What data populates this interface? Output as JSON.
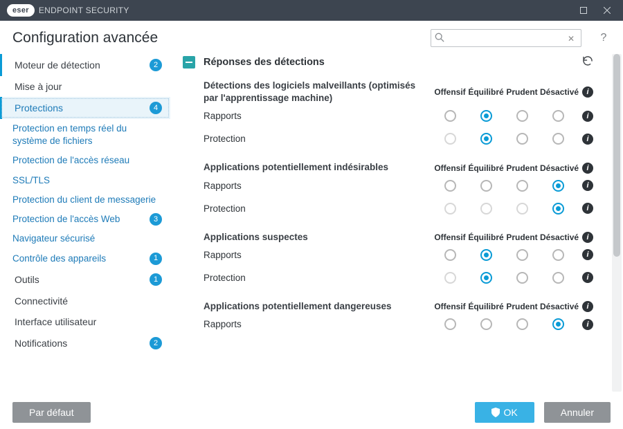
{
  "brand": {
    "capsule": "eser",
    "product": "ENDPOINT SECURITY"
  },
  "page_title": "Configuration avancée",
  "search": {
    "placeholder": ""
  },
  "sidebar": {
    "items": [
      {
        "key": "engine",
        "label": "Moteur de détection",
        "badge": "2",
        "kind": "top"
      },
      {
        "key": "update",
        "label": "Mise à jour",
        "badge": null,
        "kind": "top-plain"
      },
      {
        "key": "protections",
        "label": "Protections",
        "badge": "4",
        "kind": "selected"
      },
      {
        "key": "rtfs",
        "label": "Protection en temps réel du système de fichiers",
        "kind": "sub"
      },
      {
        "key": "net",
        "label": "Protection de l'accès réseau",
        "kind": "sub"
      },
      {
        "key": "ssl",
        "label": "SSL/TLS",
        "kind": "sub"
      },
      {
        "key": "mail",
        "label": "Protection du client de messagerie",
        "kind": "sub"
      },
      {
        "key": "web",
        "label": "Protection de l'accès Web",
        "badge": "3",
        "kind": "sub"
      },
      {
        "key": "browser",
        "label": "Navigateur sécurisé",
        "kind": "sub"
      },
      {
        "key": "devices",
        "label": "Contrôle des appareils",
        "badge": "1",
        "kind": "sub"
      },
      {
        "key": "tools",
        "label": "Outils",
        "badge": "1",
        "kind": "top-plain"
      },
      {
        "key": "conn",
        "label": "Connectivité",
        "kind": "top-plain"
      },
      {
        "key": "ui",
        "label": "Interface utilisateur",
        "kind": "top-plain"
      },
      {
        "key": "notif",
        "label": "Notifications",
        "badge": "2",
        "kind": "top-plain"
      }
    ]
  },
  "section": {
    "title": "Réponses des détections",
    "columns": [
      "Offensif",
      "Équilibré",
      "Prudent",
      "Désactivé"
    ],
    "groups": [
      {
        "title": "Détections des logiciels malveillants (optimisés par l'apprentissage machine)",
        "rows": [
          {
            "label": "Rapports",
            "sel": 1,
            "dim": []
          },
          {
            "label": "Protection",
            "sel": 1,
            "dim": [
              0
            ]
          }
        ]
      },
      {
        "title": "Applications potentiellement indésirables",
        "rows": [
          {
            "label": "Rapports",
            "sel": 3,
            "dim": []
          },
          {
            "label": "Protection",
            "sel": 3,
            "dim": [
              0,
              1,
              2
            ]
          }
        ]
      },
      {
        "title": "Applications suspectes",
        "rows": [
          {
            "label": "Rapports",
            "sel": 1,
            "dim": []
          },
          {
            "label": "Protection",
            "sel": 1,
            "dim": [
              0
            ]
          }
        ]
      },
      {
        "title": "Applications potentiellement dangereuses",
        "rows": [
          {
            "label": "Rapports",
            "sel": 3,
            "dim": []
          }
        ]
      }
    ]
  },
  "footer": {
    "default": "Par défaut",
    "ok": "OK",
    "cancel": "Annuler"
  }
}
